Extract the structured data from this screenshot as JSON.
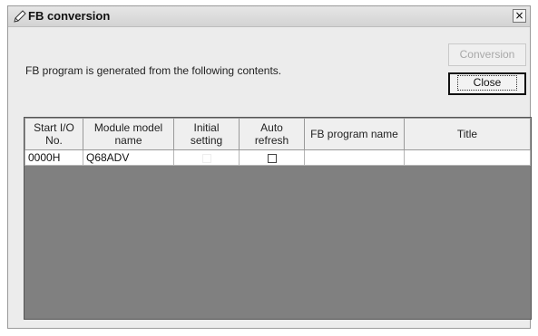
{
  "window": {
    "title": "FB conversion",
    "title_icon": "pencil-icon",
    "close_glyph": "×"
  },
  "description": "FB program is generated from the following contents.",
  "buttons": {
    "conversion": "Conversion",
    "close": "Close"
  },
  "table": {
    "headers": {
      "start_io": [
        "Start I/O",
        "No."
      ],
      "module_model": [
        "Module model",
        "name"
      ],
      "initial_setting": [
        "Initial",
        "setting"
      ],
      "auto_refresh": [
        "Auto",
        "refresh"
      ],
      "fb_program_name": "FB program name",
      "title": "Title"
    },
    "rows": [
      {
        "start_io": "0000H",
        "module_model": "Q68ADV",
        "initial_setting": false,
        "auto_refresh": false,
        "fb_program_name": "",
        "title": ""
      }
    ]
  },
  "colors": {
    "grid_background": "#808080",
    "selected_cell": "#2b2b2b"
  }
}
